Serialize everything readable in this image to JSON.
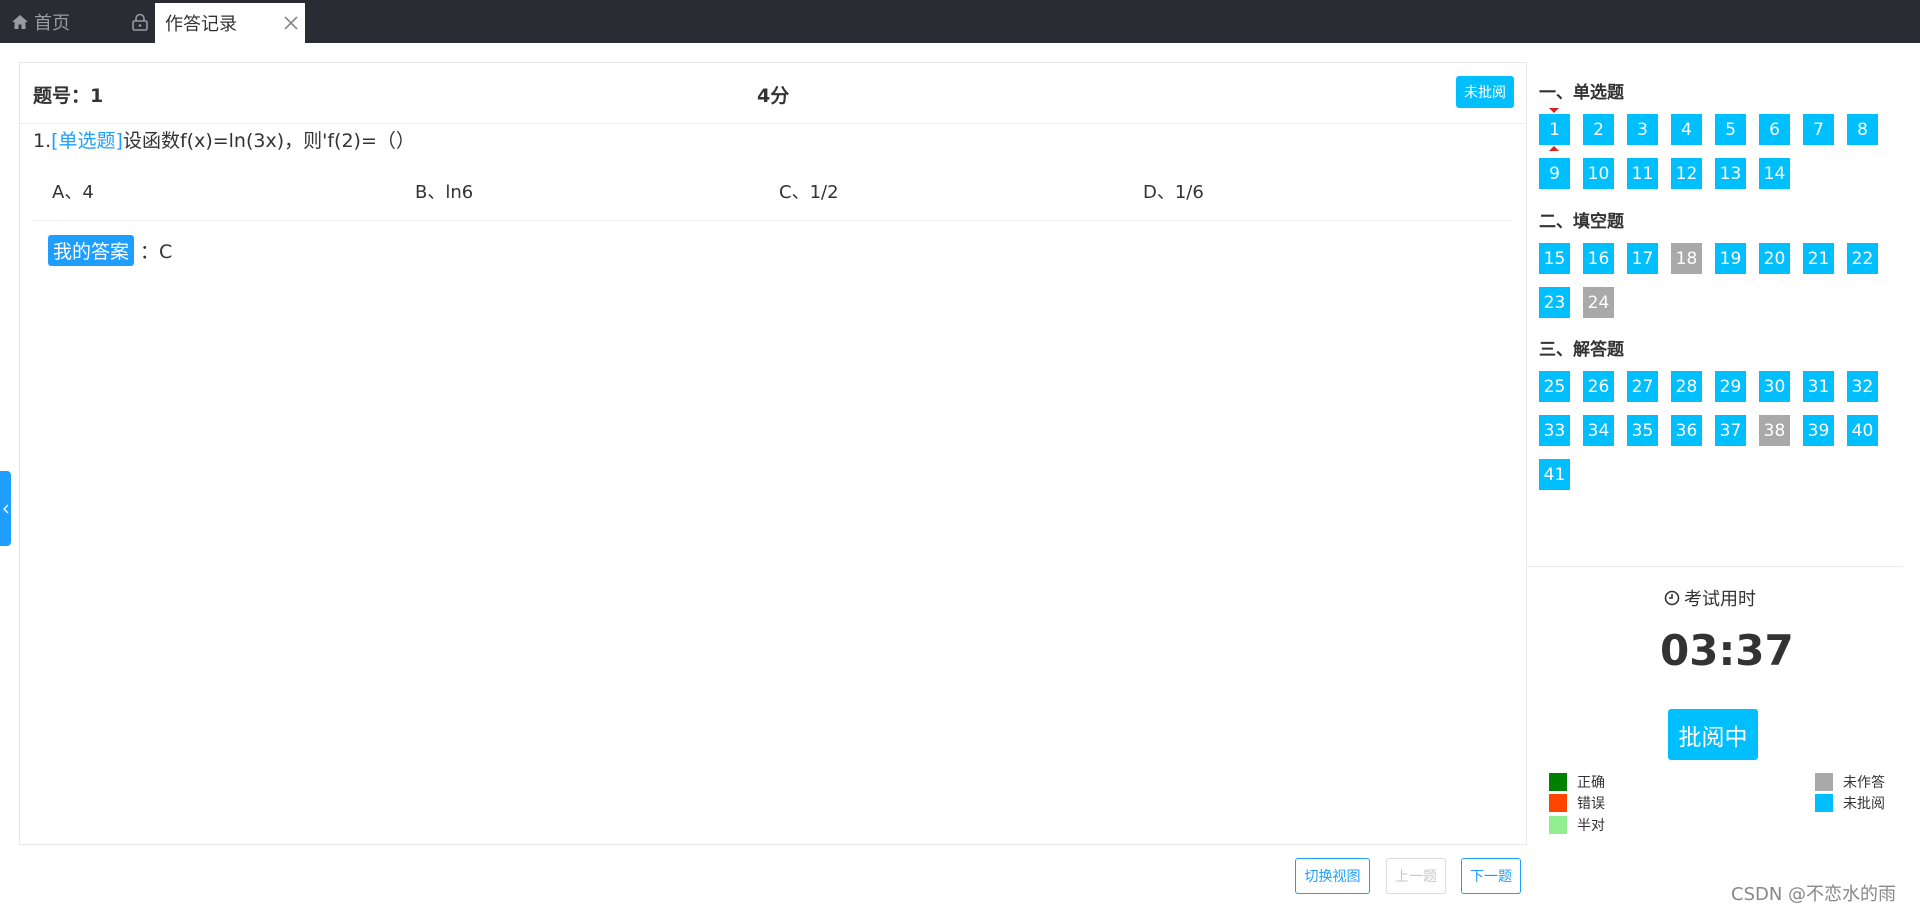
{
  "tabs": {
    "home_label": "首页",
    "active_label": "作答记录"
  },
  "question": {
    "number_label": "题号：1",
    "score": "4分",
    "status_label": "未批阅",
    "stem_prefix": "1.",
    "stem_tag": "[单选题]",
    "stem_text": "设函数f(x)=ln(3x)，则'f(2)=（）",
    "options": [
      {
        "label": "A、4"
      },
      {
        "label": "B、ln6"
      },
      {
        "label": "C、1/2"
      },
      {
        "label": "D、1/6"
      }
    ],
    "my_answer_label": "我的答案",
    "my_answer_value": "：C"
  },
  "nav_buttons": {
    "switch_view": "切换视图",
    "prev": "上一题",
    "next": "下一题"
  },
  "sidebar": {
    "sections": [
      {
        "title": "一、单选题",
        "items": [
          {
            "n": "1",
            "state": "blue",
            "current": true
          },
          {
            "n": "2",
            "state": "blue"
          },
          {
            "n": "3",
            "state": "blue"
          },
          {
            "n": "4",
            "state": "blue"
          },
          {
            "n": "5",
            "state": "blue"
          },
          {
            "n": "6",
            "state": "blue"
          },
          {
            "n": "7",
            "state": "blue"
          },
          {
            "n": "8",
            "state": "blue"
          },
          {
            "n": "9",
            "state": "blue"
          },
          {
            "n": "10",
            "state": "blue"
          },
          {
            "n": "11",
            "state": "blue"
          },
          {
            "n": "12",
            "state": "blue"
          },
          {
            "n": "13",
            "state": "blue"
          },
          {
            "n": "14",
            "state": "blue"
          }
        ]
      },
      {
        "title": "二、填空题",
        "items": [
          {
            "n": "15",
            "state": "blue"
          },
          {
            "n": "16",
            "state": "blue"
          },
          {
            "n": "17",
            "state": "blue"
          },
          {
            "n": "18",
            "state": "gray"
          },
          {
            "n": "19",
            "state": "blue"
          },
          {
            "n": "20",
            "state": "blue"
          },
          {
            "n": "21",
            "state": "blue"
          },
          {
            "n": "22",
            "state": "blue"
          },
          {
            "n": "23",
            "state": "blue"
          },
          {
            "n": "24",
            "state": "gray"
          }
        ]
      },
      {
        "title": "三、解答题",
        "items": [
          {
            "n": "25",
            "state": "blue"
          },
          {
            "n": "26",
            "state": "blue"
          },
          {
            "n": "27",
            "state": "blue"
          },
          {
            "n": "28",
            "state": "blue"
          },
          {
            "n": "29",
            "state": "blue"
          },
          {
            "n": "30",
            "state": "blue"
          },
          {
            "n": "31",
            "state": "blue"
          },
          {
            "n": "32",
            "state": "blue"
          },
          {
            "n": "33",
            "state": "blue"
          },
          {
            "n": "34",
            "state": "blue"
          },
          {
            "n": "35",
            "state": "blue"
          },
          {
            "n": "36",
            "state": "blue"
          },
          {
            "n": "37",
            "state": "blue"
          },
          {
            "n": "38",
            "state": "gray"
          },
          {
            "n": "39",
            "state": "blue"
          },
          {
            "n": "40",
            "state": "blue"
          },
          {
            "n": "41",
            "state": "blue"
          }
        ]
      }
    ],
    "timer_label": "考试用时",
    "timer_value": "03:37",
    "grading_label": "批阅中",
    "legend": [
      {
        "label": "正确",
        "color": "#008000"
      },
      {
        "label": "错误",
        "color": "#ff4500"
      },
      {
        "label": "半对",
        "color": "#90ee90"
      },
      {
        "label": "未作答",
        "color": "#a9a9a9"
      },
      {
        "label": "未批阅",
        "color": "#00bfff"
      }
    ]
  },
  "colors": {
    "topbar": "#2b2b33",
    "accent": "#1e9fff",
    "unreviewed": "#00bfff",
    "unanswered": "#a9a9a9"
  },
  "watermark": "CSDN @不恋水的雨"
}
